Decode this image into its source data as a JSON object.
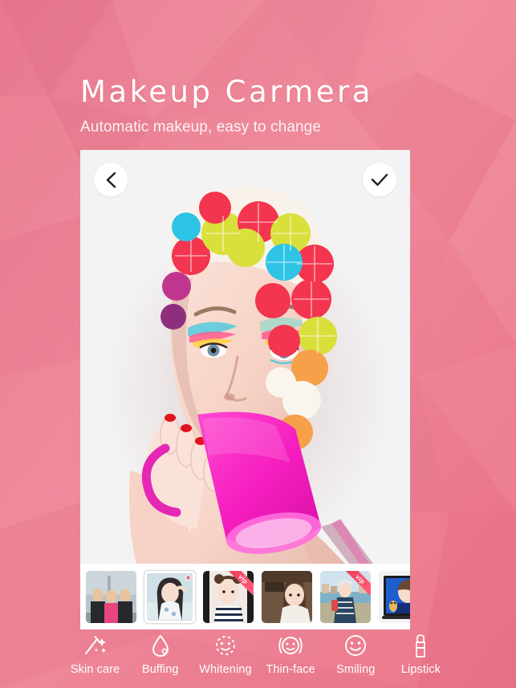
{
  "header": {
    "title": "Makeup Carmera",
    "subtitle": "Automatic makeup, easy to change"
  },
  "colors": {
    "bg_pink_light": "#ef8b9b",
    "bg_pink_mid": "#e8788b",
    "bg_pink_deep": "#e06c82",
    "panel": "#f4f3f3",
    "strip": "#ffffff",
    "vip_badge": "#f23c5a",
    "label_text": "#ffffff"
  },
  "photo_viewer": {
    "back_button": {
      "icon": "chevron-left-icon",
      "label": "Back"
    },
    "confirm_button": {
      "icon": "check-icon",
      "label": "Done"
    },
    "subject_description": "Model wearing a multicolored floral swim cap holding a magenta mug"
  },
  "thumbnails": [
    {
      "id": 1,
      "caption": "Three children on waterfront",
      "vip": false,
      "selected": false
    },
    {
      "id": 2,
      "caption": "Girl in floral top raising hand",
      "vip": false,
      "selected": true
    },
    {
      "id": 3,
      "caption": "Girl with space buns",
      "vip": true,
      "selected": false
    },
    {
      "id": 4,
      "caption": "Woman indoors with bangs",
      "vip": false,
      "selected": false
    },
    {
      "id": 5,
      "caption": "Girl by the harbour in hat",
      "vip": true,
      "selected": false
    },
    {
      "id": 6,
      "caption": "Portrait on device screen",
      "vip": false,
      "selected": false
    }
  ],
  "toolbar": {
    "items": [
      {
        "label": "Skin care",
        "icon": "magic-wand-icon"
      },
      {
        "label": "Buffing",
        "icon": "water-drop-icon"
      },
      {
        "label": "Whitening",
        "icon": "dashed-face-icon"
      },
      {
        "label": "Thin-face",
        "icon": "thin-face-icon"
      },
      {
        "label": "Smiling",
        "icon": "smiley-face-icon"
      },
      {
        "label": "Lipstick",
        "icon": "lipstick-icon"
      }
    ]
  }
}
